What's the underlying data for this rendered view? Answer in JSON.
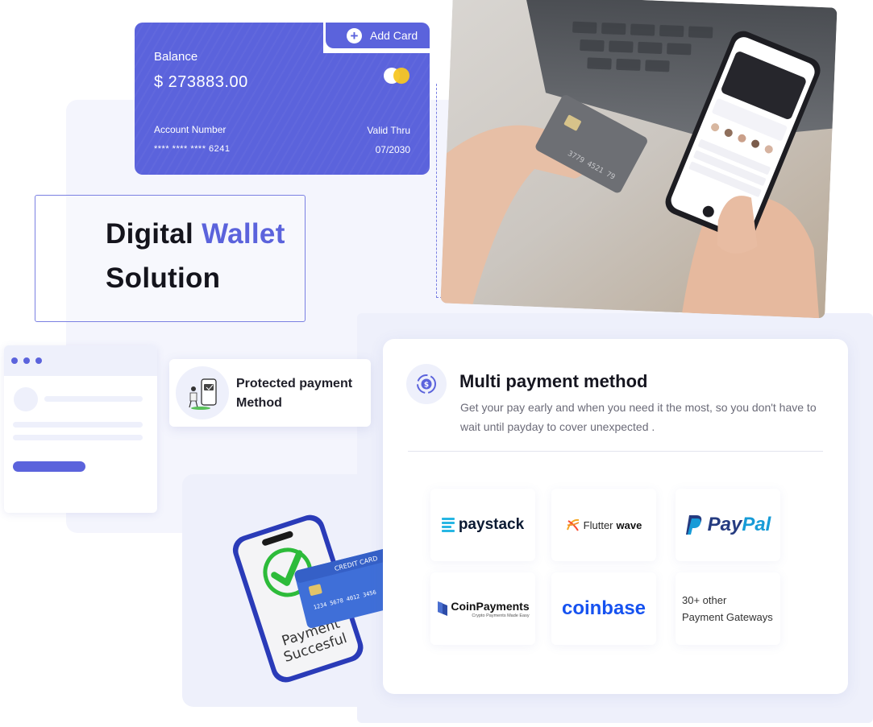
{
  "balance_card": {
    "add_card_label": "Add Card",
    "balance_label": "Balance",
    "balance_amount": "$ 273883.00",
    "account_label": "Account Number",
    "account_value": "**** **** **** 6241",
    "valid_label": "Valid Thru",
    "valid_value": "07/2030"
  },
  "hero": {
    "title_part1": "Digital ",
    "title_accent": "Wallet",
    "title_part2": "Solution"
  },
  "protected": {
    "line1": "Protected payment",
    "line2": "Method"
  },
  "success_illustration": {
    "card_label": "CREDIT CARD",
    "card_number": "1234 5678 4012 3456",
    "text_line1": "Payment",
    "text_line2": "Succesful"
  },
  "multi_payment": {
    "title": "Multi payment method",
    "description": "Get your pay early and when you need it the most, so you don't have to wait until payday to cover unexpected ."
  },
  "gateways": {
    "paystack": "paystack",
    "flutterwave_a": "Flutter",
    "flutterwave_b": "wave",
    "paypal_a": "Pay",
    "paypal_b": "Pal",
    "coinpayments": "CoinPayments",
    "coinpayments_tag": "Crypto Payments Made Easy",
    "coinbase": "coinbase",
    "others_line1": "30+ other",
    "others_line2": "Payment Gateways"
  },
  "colors": {
    "accent": "#5b63dc",
    "panel": "#eef0fb",
    "success_green": "#2dbb3a"
  }
}
